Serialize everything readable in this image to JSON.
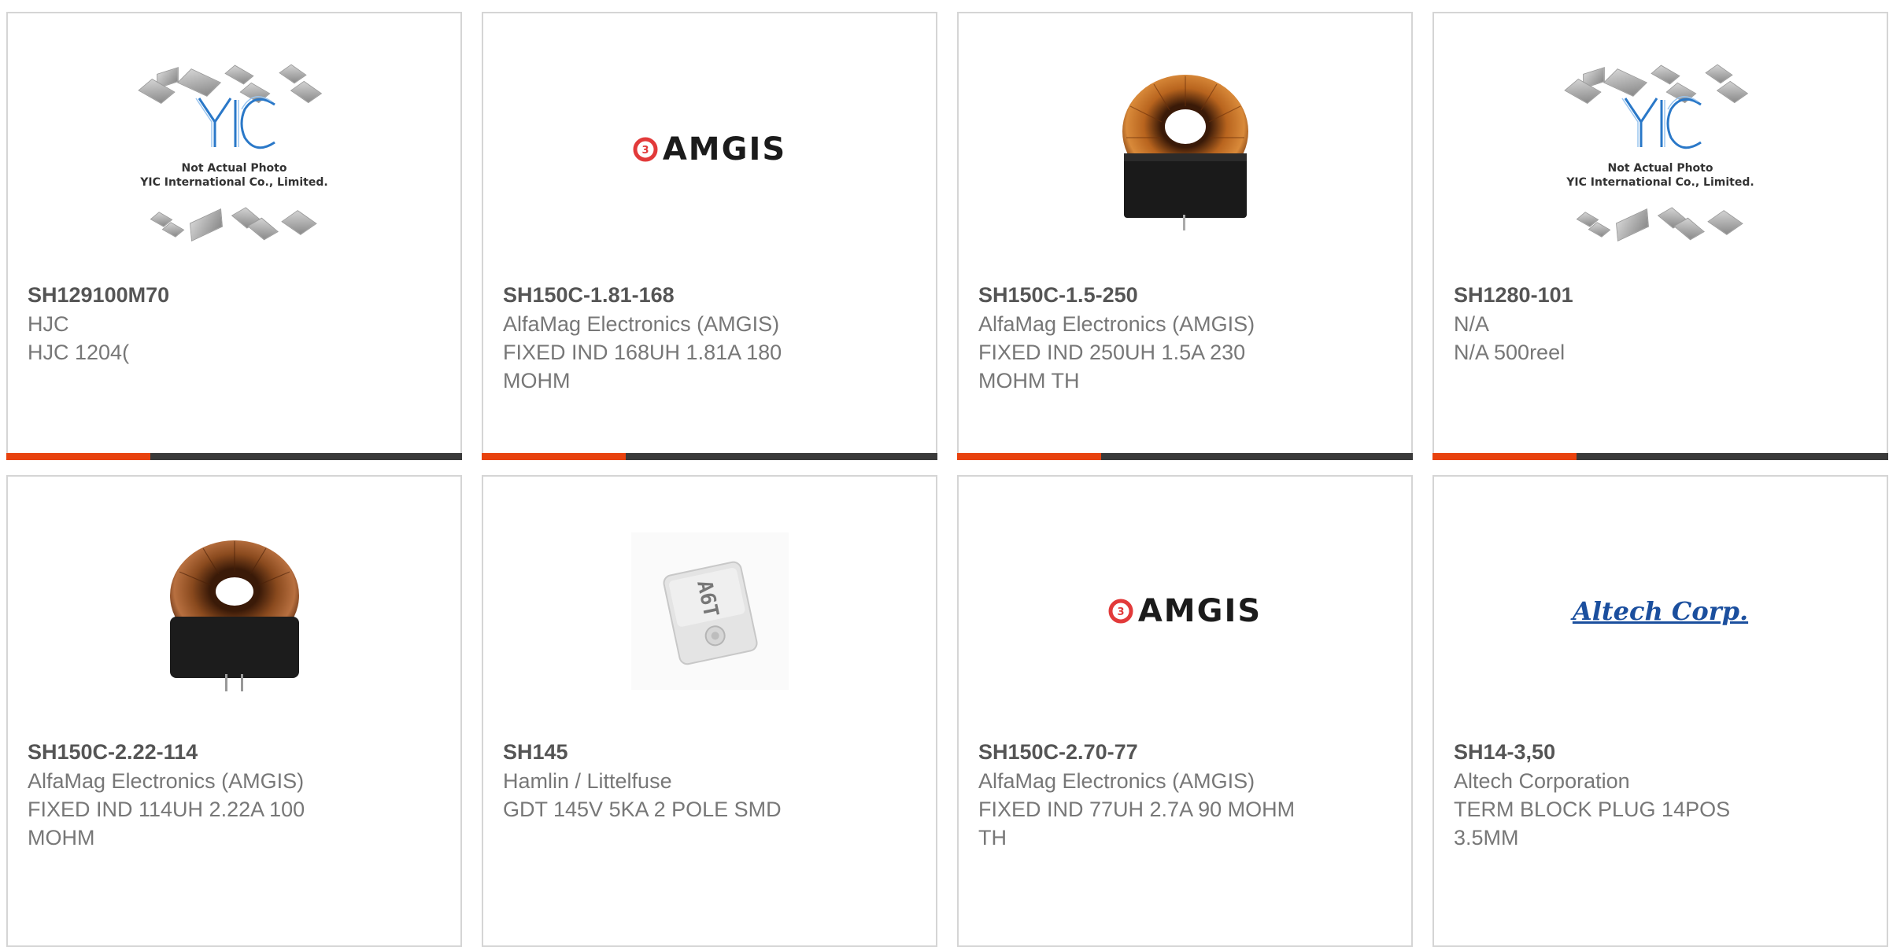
{
  "placeholder": {
    "logo_text": "YIC",
    "line1": "Not Actual Photo",
    "line2": "YIC International Co., Limited."
  },
  "brand_logos": {
    "amgis": "AMGIS",
    "altech": "Altech Corp."
  },
  "colors": {
    "accent": "#e8420e",
    "bar": "#3a3a3a",
    "border": "#d5d5d5",
    "mpn_text": "#555555",
    "detail_text": "#777777"
  },
  "products": [
    {
      "mpn": "SH129100M70",
      "manufacturer": "HJC",
      "desc1": "HJC 1204(",
      "desc2": "",
      "image": "not-actual-photo"
    },
    {
      "mpn": "SH150C-1.81-168",
      "manufacturer": "AlfaMag Electronics (AMGIS)",
      "desc1": "FIXED IND 168UH 1.81A 180",
      "desc2": "MOHM",
      "image": "amgis-logo"
    },
    {
      "mpn": "SH150C-1.5-250",
      "manufacturer": "AlfaMag Electronics (AMGIS)",
      "desc1": "FIXED IND 250UH 1.5A 230",
      "desc2": "MOHM TH",
      "image": "toroid-inductor"
    },
    {
      "mpn": "SH1280-101",
      "manufacturer": "N/A",
      "desc1": "N/A 500reel",
      "desc2": "",
      "image": "not-actual-photo"
    },
    {
      "mpn": "SH150C-2.22-114",
      "manufacturer": "AlfaMag Electronics (AMGIS)",
      "desc1": "FIXED IND 114UH 2.22A 100",
      "desc2": "MOHM",
      "image": "toroid-inductor"
    },
    {
      "mpn": "SH145",
      "manufacturer": "Hamlin / Littelfuse",
      "desc1": "GDT 145V 5KA 2 POLE SMD",
      "desc2": "",
      "image": "gdt-component",
      "component_marking": "A6T"
    },
    {
      "mpn": "SH150C-2.70-77",
      "manufacturer": "AlfaMag Electronics (AMGIS)",
      "desc1": "FIXED IND 77UH 2.7A 90 MOHM",
      "desc2": "TH",
      "image": "amgis-logo"
    },
    {
      "mpn": "SH14-3,50",
      "manufacturer": "Altech Corporation",
      "desc1": "TERM BLOCK PLUG 14POS",
      "desc2": "3.5MM",
      "image": "altech-logo"
    }
  ]
}
